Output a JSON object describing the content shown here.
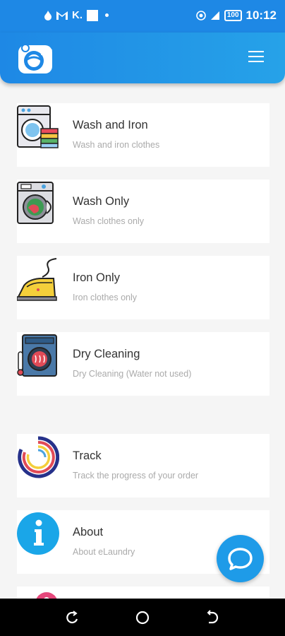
{
  "status": {
    "left_text": "K.",
    "time": "10:12",
    "battery": "100"
  },
  "app_bar": {
    "logo_icon": "eLaundry washing-machine logo",
    "menu_icon": "hamburger-menu-icon"
  },
  "services": [
    {
      "title": "Wash and Iron",
      "subtitle": "Wash and iron clothes",
      "icon": "washer-with-clothes-icon"
    },
    {
      "title": "Wash Only",
      "subtitle": "Wash clothes only",
      "icon": "washing-machine-icon"
    },
    {
      "title": "Iron Only",
      "subtitle": "Iron clothes only",
      "icon": "iron-icon"
    },
    {
      "title": "Dry Cleaning",
      "subtitle": "Dry Cleaning (Water not used)",
      "icon": "dry-cleaning-machine-icon"
    }
  ],
  "extras": [
    {
      "title": "Track",
      "subtitle": "Track the progress of your order",
      "icon": "progress-rings-icon"
    },
    {
      "title": "About",
      "subtitle": "About eLaundry",
      "icon": "info-icon"
    }
  ],
  "colors": {
    "primary": "#1e88e5",
    "fab": "#1e9be8",
    "background": "#f5f5f5"
  }
}
